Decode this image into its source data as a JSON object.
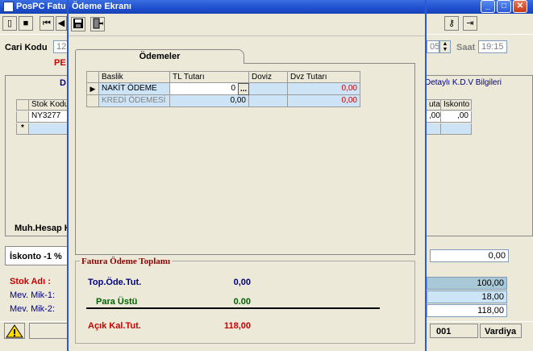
{
  "bg": {
    "title": "PosPC Fatu",
    "cari_kodu_label": "Cari Kodu",
    "cari_kodu_value": "12",
    "pe_text": "PE",
    "date_fragment": "05",
    "saat_label": "Saat",
    "saat_value": "19:15",
    "left_panel_header": "D",
    "stok_kodu_header": "Stok Kodu",
    "stok_kodu_row1": "NY3277",
    "new_row_marker": "*",
    "muh_hesap_label": "Muh.Hesap K",
    "iskonto_label": "İskonto -1 %",
    "stok_adi_label": "Stok Adı :",
    "mev_mik1_label": "Mev. Mik-1:",
    "mev_mik2_label": "Mev. Mik-2:",
    "right_header": "Detaylı K.D.V Bilgileri",
    "right_col1_header": "utar",
    "right_col2_header": "İskonto",
    "right_col1_value": ",00",
    "right_col2_value": ",00",
    "right_field1": "0,00",
    "right_total1": "100,00",
    "right_total2": "18,00",
    "right_total3": "118,00",
    "status_code": "001",
    "vardiya_label": "Vardiya"
  },
  "modal": {
    "title": "Ödeme Ekranı",
    "tab_label": "Ödemeler",
    "columns": [
      "Baslik",
      "TL Tutarı",
      "Doviz",
      "Dvz Tutarı"
    ],
    "rows": [
      {
        "baslik": "NAKİT ÖDEME",
        "tl": "0",
        "doviz": "",
        "dvz": "0,00"
      },
      {
        "baslik": "KREDİ ÖDEMESİ",
        "tl": "0,00",
        "doviz": "",
        "dvz": "0,00"
      }
    ],
    "ellipsis": "...",
    "totals": {
      "legend": "Fatura Ödeme Toplamı",
      "top_ode_label": "Top.Öde.Tut.",
      "top_ode_value": "0,00",
      "para_ustu_label": "Para Üstü",
      "para_ustu_value": "0.00",
      "acik_kal_label": "Açık Kal.Tut.",
      "acik_kal_value": "118,00"
    }
  },
  "colors": {
    "title_blue": "#1f4fcf",
    "grid_blue": "#cde4f7",
    "red_value": "#cc0000",
    "green_value": "#006400",
    "navy_value": "#000080",
    "dark_red_label": "#8b0000"
  },
  "icons": [
    "window-icon",
    "new-doc-icon",
    "save-icon",
    "first-record-icon",
    "prev-record-icon",
    "exit-door-icon",
    "key-icon",
    "warning-icon",
    "minimize-icon",
    "maximize-icon",
    "close-icon"
  ]
}
